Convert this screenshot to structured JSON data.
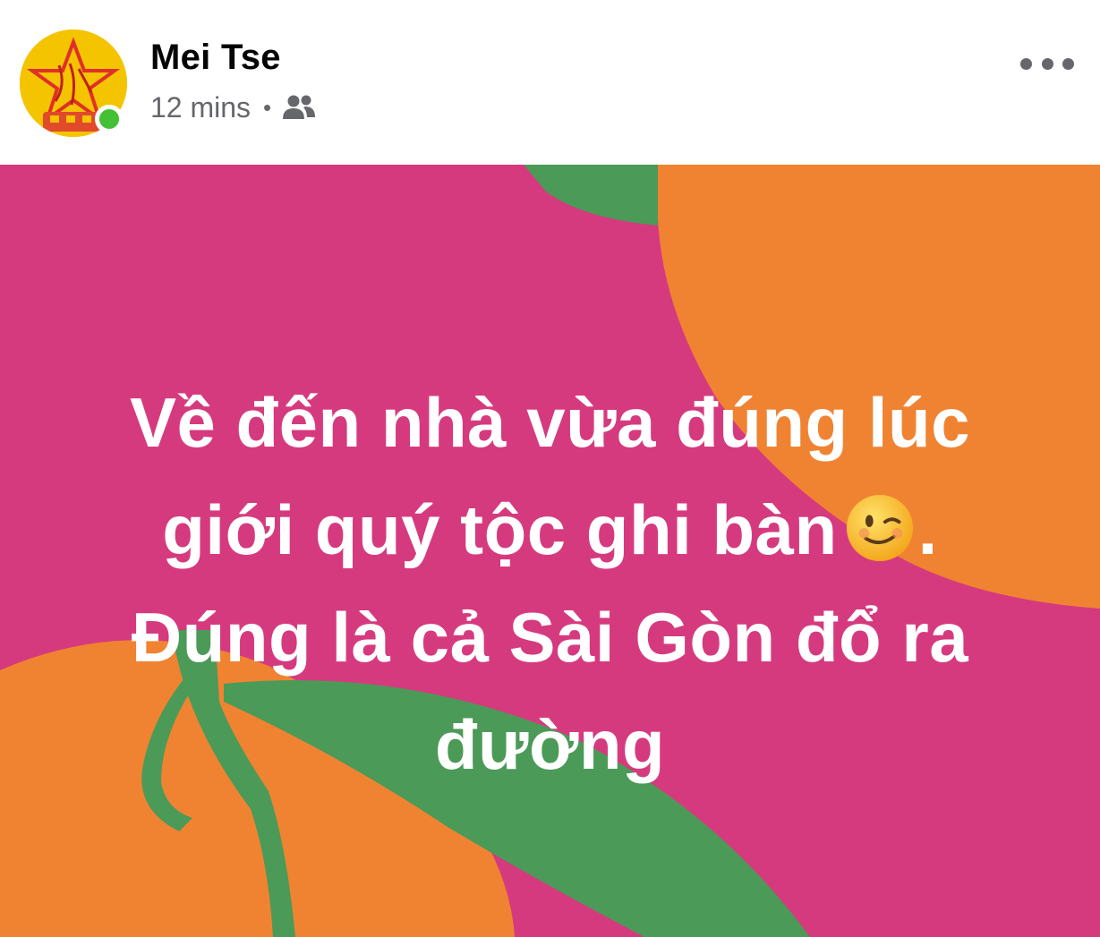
{
  "post": {
    "author": {
      "name": "Mei Tse",
      "avatar_icon": "avatar-star-logo",
      "online_status": "online",
      "online_color": "#43c033"
    },
    "timestamp": "12 mins",
    "separator": "•",
    "audience_icon": "friends-audience-icon",
    "more_icon": "more-options-icon",
    "text_lines": [
      "Về đến nhà vừa đúng lúc",
      "giới quý tộc ghi bàn",
      ".",
      "Đúng là cả Sài Gòn đổ ra",
      "đường"
    ],
    "emoji": "winking-face-icon",
    "background": {
      "pink": "#d63a7e",
      "orange": "#f08332",
      "green": "#4b9a57"
    }
  }
}
